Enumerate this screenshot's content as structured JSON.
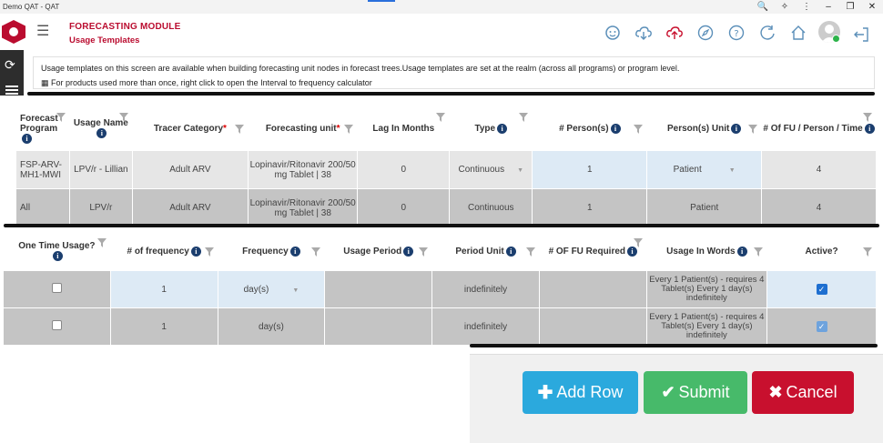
{
  "window": {
    "title": "Demo QAT - QAT"
  },
  "header": {
    "module_title": "FORECASTING MODULE",
    "page_title": "Usage Templates",
    "icons": [
      "chat-support-icon",
      "cloud-download-icon",
      "cloud-upload-icon",
      "compass-icon",
      "help-icon",
      "refresh-icon",
      "home-icon",
      "user-avatar-icon",
      "logout-icon"
    ]
  },
  "notice": {
    "line1": "Usage templates on this screen are available when building forecasting unit nodes in forecast trees.Usage templates are set at the realm (across all programs) or program level.",
    "line2": "For products used more than once, right click to open the Interval to frequency calculator"
  },
  "table1": {
    "headers": {
      "forecast_program": "Forecast Program",
      "usage_name": "Usage Name",
      "tracer_category": "Tracer Category",
      "forecasting_unit": "Forecasting unit",
      "lag_in_months": "Lag In Months",
      "type": "Type",
      "persons": "# Person(s)",
      "person_unit": "Person(s) Unit",
      "fu_per_time": "# Of FU / Person / Time"
    },
    "rows": [
      {
        "program": "FSP-ARV-MH1-MWI",
        "usage_name": "LPV/r - Lillian",
        "tracer": "Adult ARV",
        "fu": "Lopinavir/Ritonavir 200/50 mg Tablet | 38",
        "lag": "0",
        "type": "Continuous",
        "persons": "1",
        "person_unit": "Patient",
        "fu_per_time": "4"
      },
      {
        "program": "All",
        "usage_name": "LPV/r",
        "tracer": "Adult ARV",
        "fu": "Lopinavir/Ritonavir 200/50 mg Tablet | 38",
        "lag": "0",
        "type": "Continuous",
        "persons": "1",
        "person_unit": "Patient",
        "fu_per_time": "4"
      }
    ]
  },
  "table2": {
    "headers": {
      "one_time_usage": "One Time Usage?",
      "num_frequency": "# of frequency",
      "frequency": "Frequency",
      "usage_period": "Usage Period",
      "period_unit": "Period Unit",
      "fu_required": "# OF FU Required",
      "usage_in_words": "Usage In Words",
      "active": "Active?"
    },
    "rows": [
      {
        "one_time": false,
        "num_freq": "1",
        "frequency": "day(s)",
        "usage_period": "",
        "period_unit": "indefinitely",
        "fu_required": "",
        "words": "Every 1 Patient(s) - requires 4 Tablet(s) Every 1 day(s) indefinitely",
        "active": true
      },
      {
        "one_time": false,
        "num_freq": "1",
        "frequency": "day(s)",
        "usage_period": "",
        "period_unit": "indefinitely",
        "fu_required": "",
        "words": "Every 1 Patient(s) - requires 4 Tablet(s)  Every 1 day(s) indefinitely",
        "active": true
      }
    ]
  },
  "actions": {
    "add_row": "Add Row",
    "submit": "Submit",
    "cancel": "Cancel"
  },
  "colors": {
    "brand": "#ba0c2f",
    "add": "#2ba9dd",
    "submit": "#47ba6a",
    "cancel": "#c8102e"
  }
}
